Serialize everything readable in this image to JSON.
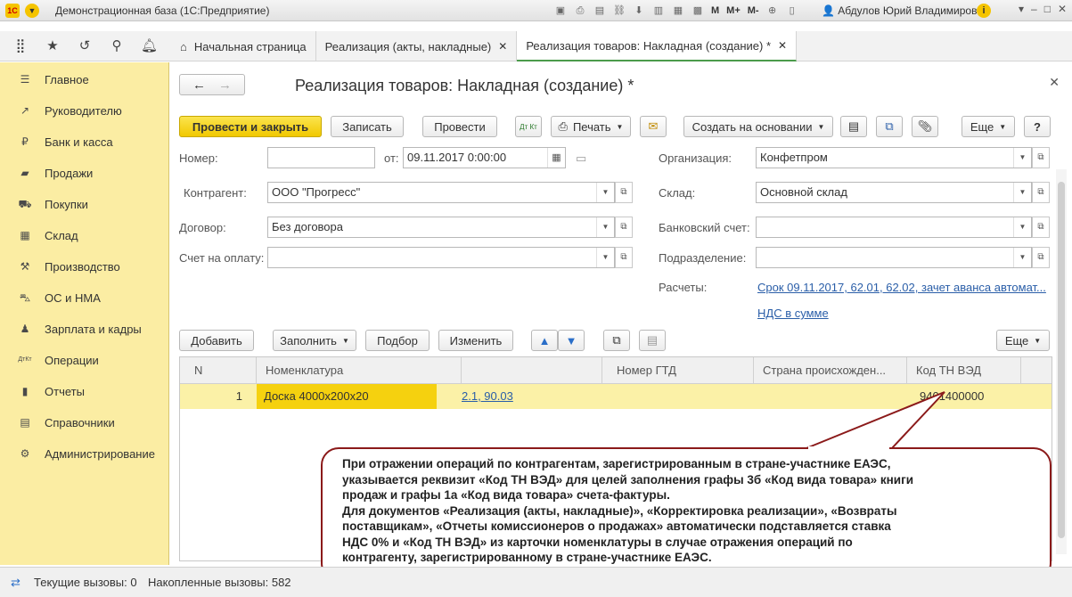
{
  "window": {
    "app_title": "Демонстрационная база (1С:Предприятие)",
    "toolbar_labels": [
      "M",
      "M+",
      "M-"
    ],
    "user": "Абдулов Юрий Владимирович",
    "logo_text": "1С"
  },
  "tabs": [
    {
      "label": "Начальная страница"
    },
    {
      "label": "Реализация (акты, накладные)"
    },
    {
      "label": "Реализация товаров: Накладная (создание) *"
    }
  ],
  "sidebar": {
    "items": [
      {
        "label": "Главное",
        "icon": "list-icon"
      },
      {
        "label": "Руководителю",
        "icon": "chart-icon"
      },
      {
        "label": "Банк и касса",
        "icon": "coin-icon"
      },
      {
        "label": "Продажи",
        "icon": "bag-icon"
      },
      {
        "label": "Покупки",
        "icon": "cart-icon"
      },
      {
        "label": "Склад",
        "icon": "warehouse-icon"
      },
      {
        "label": "Производство",
        "icon": "factory-icon"
      },
      {
        "label": "ОС и НМА",
        "icon": "car-icon"
      },
      {
        "label": "Зарплата и кадры",
        "icon": "person-icon"
      },
      {
        "label": "Операции",
        "icon": "dt-kt-icon"
      },
      {
        "label": "Отчеты",
        "icon": "bar-chart-icon"
      },
      {
        "label": "Справочники",
        "icon": "book-icon"
      },
      {
        "label": "Администрирование",
        "icon": "gear-icon"
      }
    ]
  },
  "document": {
    "title": "Реализация товаров: Накладная (создание) *",
    "buttons": {
      "post_close": "Провести и закрыть",
      "save": "Записать",
      "post": "Провести",
      "print": "Печать",
      "create_based": "Создать на основании",
      "more": "Еще",
      "help": "?",
      "dt_kt": "Дт Кт"
    },
    "fields": {
      "number_label": "Номер:",
      "number_value": "",
      "from_label": "от:",
      "date_value": "09.11.2017  0:00:00",
      "org_label": "Организация:",
      "org_value": "Конфетпром",
      "contractor_label": "Контрагент:",
      "contractor_value": "ООО \"Прогресс\"",
      "warehouse_label": "Склад:",
      "warehouse_value": "Основной склад",
      "contract_label": "Договор:",
      "contract_value": "Без договора",
      "bank_label": "Банковский счет:",
      "bank_value": "",
      "invoice_label": "Счет на оплату:",
      "invoice_value": "",
      "division_label": "Подразделение:",
      "division_value": "",
      "settlements_label": "Расчеты:",
      "settlements_link": "Срок 09.11.2017, 62.01, 62.02, зачет аванса автомат...",
      "vat_link": "НДС в сумме"
    },
    "grid_toolbar": {
      "add": "Добавить",
      "fill": "Заполнить",
      "pick": "Подбор",
      "change": "Изменить",
      "more": "Еще"
    },
    "grid": {
      "columns": [
        "N",
        "Номенклатура",
        "",
        "Номер ГТД",
        "Страна происхожден...",
        "Код ТН ВЭД"
      ],
      "rows": [
        {
          "n": "1",
          "item": "Доска 4000х200х20",
          "account": "2.1, 90.03",
          "gtd": "",
          "country": "",
          "tnved": "9401400000"
        }
      ]
    }
  },
  "callout": {
    "lines": [
      "При отражении операций по контрагентам, зарегистрированным в стране-участнике ЕАЭС,",
      "указывается реквизит «Код ТН ВЭД» для целей заполнения графы 3б «Код вида товара» книги",
      "продаж и графы 1а «Код вида товара» счета-фактуры.",
      "Для документов «Реализация (акты, накладные)», «Корректировка реализации», «Возвраты",
      "поставщикам», «Отчеты комиссионеров о продажах»  автоматически подставляется ставка",
      "НДС 0% и «Код ТН ВЭД» из карточки номенклатуры в случае отражения операций по",
      "контрагенту, зарегистрированному в стране-участнике ЕАЭС."
    ]
  },
  "statusbar": {
    "current_calls": "Текущие вызовы: 0",
    "accumulated_calls": "Накопленные вызовы: 582"
  },
  "colors": {
    "sidebar_bg": "#fbeda3",
    "primary_button": "#f1c800",
    "selected_row": "#fbf1a7",
    "link": "#2a5ea8",
    "callout_border": "#8b1a1a"
  }
}
